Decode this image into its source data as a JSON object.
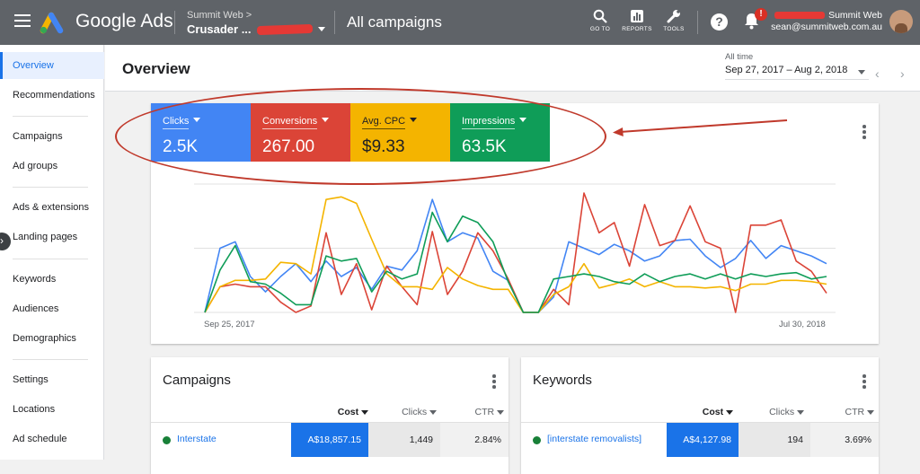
{
  "topbar": {
    "brand": "Google Ads",
    "account_parent": "Summit Web >",
    "account_name": "Crusader ...",
    "page_title": "All campaigns",
    "tools": [
      {
        "label": "GO TO",
        "icon": "search-icon"
      },
      {
        "label": "REPORTS",
        "icon": "reports-icon"
      },
      {
        "label": "TOOLS",
        "icon": "wrench-icon"
      }
    ],
    "help_icon": "?",
    "notification_badge": "!",
    "user_org": "Summit Web",
    "user_email": "sean@summitweb.com.au"
  },
  "sidebar": {
    "items": [
      {
        "label": "Overview",
        "active": true
      },
      {
        "label": "Recommendations"
      },
      {
        "label": "Campaigns"
      },
      {
        "label": "Ad groups"
      },
      {
        "label": "Ads & extensions"
      },
      {
        "label": "Landing pages"
      },
      {
        "label": "Keywords"
      },
      {
        "label": "Audiences"
      },
      {
        "label": "Demographics"
      },
      {
        "label": "Settings"
      },
      {
        "label": "Locations"
      },
      {
        "label": "Ad schedule"
      }
    ]
  },
  "header": {
    "title": "Overview",
    "date_label": "All time",
    "date_range": "Sep 27, 2017 – Aug 2, 2018"
  },
  "metrics": [
    {
      "name": "Clicks",
      "value": "2.5K",
      "color": "#4285F4"
    },
    {
      "name": "Conversions",
      "value": "267.00",
      "color": "#DB4437"
    },
    {
      "name": "Avg. CPC",
      "value": "$9.33",
      "color": "#F4B400"
    },
    {
      "name": "Impressions",
      "value": "63.5K",
      "color": "#0F9D58"
    }
  ],
  "chart_data": {
    "type": "line",
    "x_start_label": "Sep 25, 2017",
    "x_end_label": "Jul 30, 2018",
    "grid": true,
    "series": [
      {
        "color": "#4285F4",
        "values": [
          0.0,
          0.5,
          0.55,
          0.28,
          0.16,
          0.28,
          0.38,
          0.24,
          0.4,
          0.28,
          0.35,
          0.18,
          0.36,
          0.33,
          0.48,
          0.88,
          0.55,
          0.62,
          0.58,
          0.32,
          0.25,
          0.0,
          0.0,
          0.12,
          0.55,
          0.5,
          0.45,
          0.53,
          0.48,
          0.4,
          0.44,
          0.56,
          0.57,
          0.44,
          0.35,
          0.42,
          0.56,
          0.42,
          0.52,
          0.48,
          0.44,
          0.38
        ]
      },
      {
        "color": "#DB4437",
        "values": [
          0.0,
          0.2,
          0.22,
          0.2,
          0.2,
          0.08,
          0.0,
          0.05,
          0.62,
          0.14,
          0.38,
          0.02,
          0.36,
          0.2,
          0.06,
          0.63,
          0.14,
          0.32,
          0.62,
          0.48,
          0.26,
          0.0,
          0.0,
          0.18,
          0.06,
          0.93,
          0.62,
          0.7,
          0.36,
          0.84,
          0.52,
          0.56,
          0.83,
          0.55,
          0.5,
          0.0,
          0.68,
          0.68,
          0.72,
          0.4,
          0.32,
          0.15
        ]
      },
      {
        "color": "#F4B400",
        "values": [
          0.0,
          0.2,
          0.25,
          0.25,
          0.26,
          0.39,
          0.38,
          0.3,
          0.88,
          0.9,
          0.85,
          0.57,
          0.3,
          0.2,
          0.2,
          0.18,
          0.35,
          0.26,
          0.21,
          0.18,
          0.18,
          0.0,
          0.0,
          0.14,
          0.2,
          0.38,
          0.19,
          0.22,
          0.26,
          0.2,
          0.24,
          0.2,
          0.2,
          0.19,
          0.2,
          0.17,
          0.22,
          0.22,
          0.25,
          0.25,
          0.24,
          0.22
        ]
      },
      {
        "color": "#0F9D58",
        "values": [
          0.0,
          0.33,
          0.52,
          0.24,
          0.22,
          0.15,
          0.06,
          0.06,
          0.44,
          0.4,
          0.42,
          0.16,
          0.32,
          0.26,
          0.3,
          0.78,
          0.55,
          0.75,
          0.7,
          0.55,
          0.24,
          0.0,
          0.0,
          0.26,
          0.28,
          0.3,
          0.28,
          0.24,
          0.22,
          0.3,
          0.24,
          0.28,
          0.3,
          0.26,
          0.3,
          0.26,
          0.3,
          0.28,
          0.3,
          0.31,
          0.26,
          0.28
        ]
      }
    ]
  },
  "campaigns": {
    "title": "Campaigns",
    "columns": [
      "Cost",
      "Clicks",
      "CTR"
    ],
    "rows": [
      {
        "name": "Interstate",
        "cost": "A$18,857.15",
        "clicks": "1,449",
        "ctr": "2.84%"
      }
    ]
  },
  "keywords": {
    "title": "Keywords",
    "columns": [
      "Cost",
      "Clicks",
      "CTR"
    ],
    "rows": [
      {
        "name": "[interstate removalists]",
        "cost": "A$4,127.98",
        "clicks": "194",
        "ctr": "3.69%"
      }
    ]
  }
}
